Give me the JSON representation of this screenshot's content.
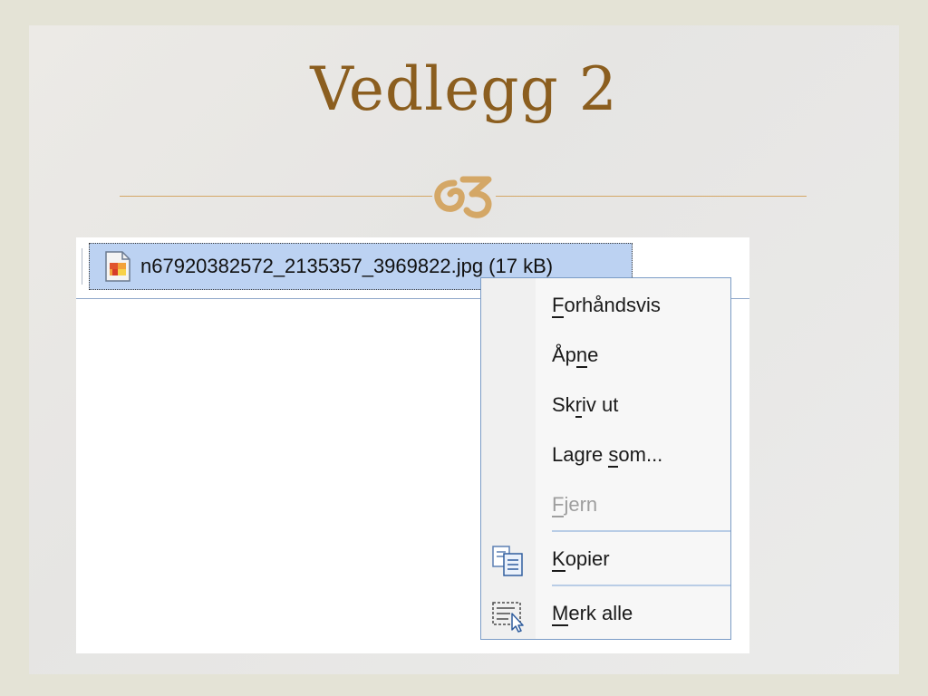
{
  "slide": {
    "title": "Vedlegg 2"
  },
  "attachment": {
    "filename": "n67920382572_2135357_3969822.jpg (17 kB)",
    "icon": "image-file-icon"
  },
  "context_menu": {
    "items": [
      {
        "pre": "",
        "key": "F",
        "post": "orhåndsvis",
        "enabled": true,
        "icon": ""
      },
      {
        "pre": "Åp",
        "key": "n",
        "post": "e",
        "enabled": true,
        "icon": ""
      },
      {
        "pre": "Sk",
        "key": "r",
        "post": "iv ut",
        "enabled": true,
        "icon": ""
      },
      {
        "pre": "Lagre ",
        "key": "s",
        "post": "om...",
        "enabled": true,
        "icon": ""
      },
      {
        "pre": "",
        "key": "F",
        "post": "jern",
        "enabled": false,
        "icon": ""
      },
      {
        "pre": "",
        "key": "K",
        "post": "opier",
        "enabled": true,
        "icon": "copy-icon"
      },
      {
        "pre": "",
        "key": "M",
        "post": "erk alle",
        "enabled": true,
        "icon": "select-all-icon"
      }
    ]
  },
  "colors": {
    "title": "#8b5e1f",
    "accent_rule": "#d4a766",
    "selection": "#bcd2f2",
    "menu_border": "#7b9cc6"
  }
}
